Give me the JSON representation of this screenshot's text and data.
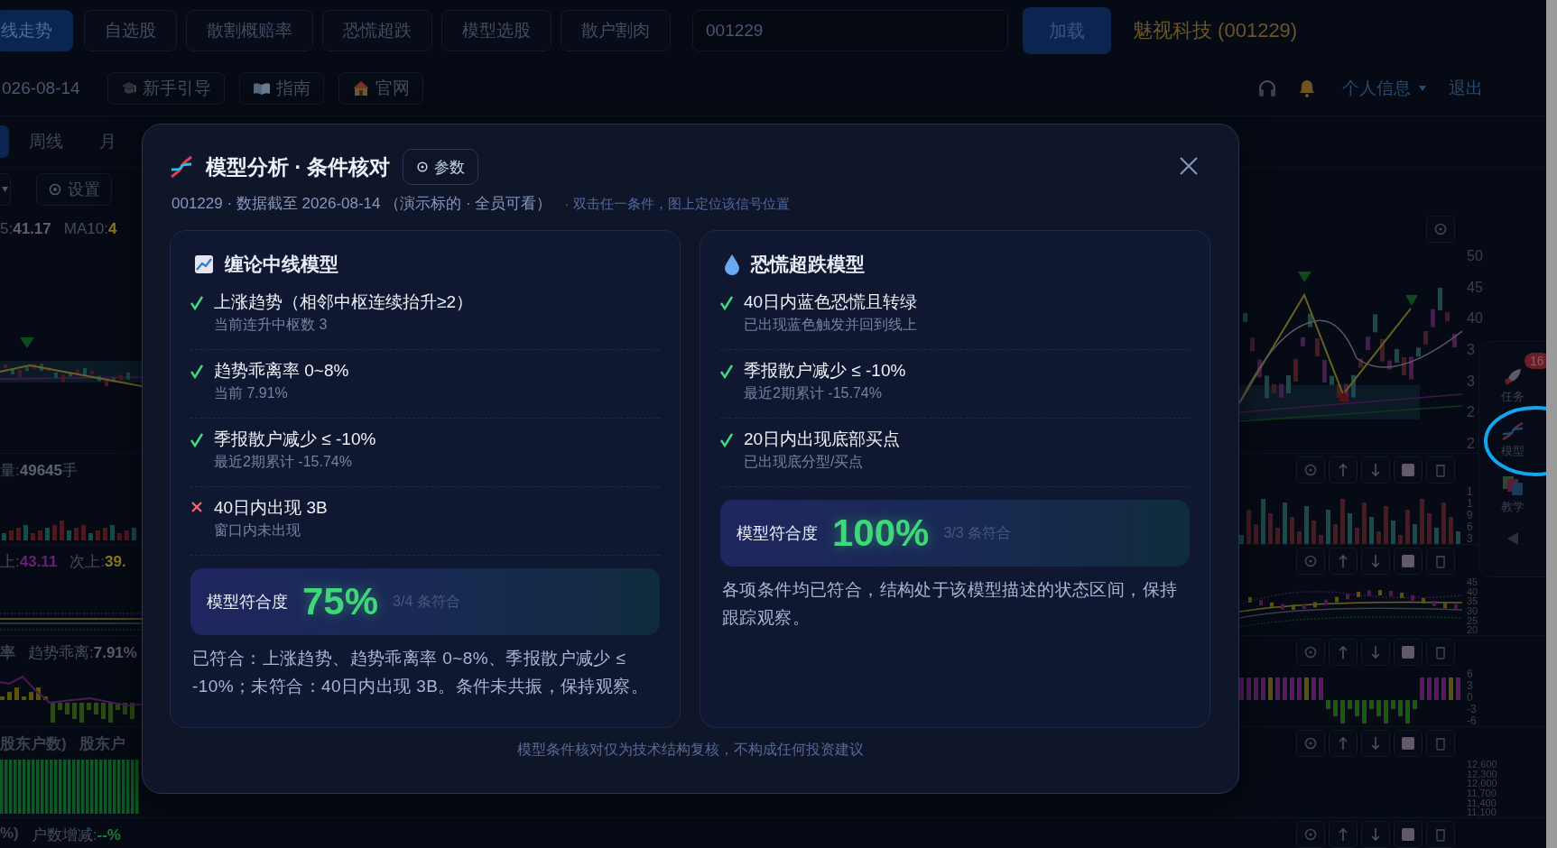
{
  "top_tabs": [
    {
      "label": "线走势",
      "selected": true
    },
    {
      "label": "自选股",
      "selected": false
    },
    {
      "label": "散割概赔率",
      "selected": false
    },
    {
      "label": "恐慌超跌",
      "selected": false
    },
    {
      "label": "模型选股",
      "selected": false
    },
    {
      "label": "散户割肉",
      "selected": false
    }
  ],
  "code_input": {
    "value": "001229"
  },
  "load_button": "加载",
  "stock_name": "魅视科技 (001229)",
  "date": "026-08-14",
  "link_buttons": [
    "新手引导",
    "指南",
    "官网"
  ],
  "user_menu": {
    "label": "个人信息",
    "logout": "退出"
  },
  "period_tabs": [
    {
      "selected": true
    },
    {
      "label": "周线",
      "selected": false
    },
    {
      "label": "月",
      "selected": false
    }
  ],
  "settings_button": "设置",
  "panes": [
    {
      "kind": "price",
      "labels": [
        {
          "label": "5:",
          "value": "41.17"
        },
        {
          "label": "MA10:",
          "value": "4",
          "color": "#8a7d1c"
        }
      ],
      "ticks": [
        "50",
        "45",
        "40",
        "3",
        "3",
        "2",
        "2"
      ]
    },
    {
      "kind": "volume",
      "labels": [
        {
          "label": "量:",
          "value": "49645",
          "suffix": "手"
        }
      ],
      "ticks": [
        "1",
        "1",
        "9",
        "6",
        "3"
      ]
    },
    {
      "kind": "lines",
      "labels": [
        {
          "label": "上:",
          "value": "43.11",
          "color": "#6a1f78"
        },
        {
          "label": "次上:",
          "value": "39.",
          "color": "#8a7d1c"
        }
      ],
      "ticks": [
        "45",
        "40",
        "35",
        "30",
        "25",
        "20"
      ]
    },
    {
      "kind": "macd",
      "labels": [
        {
          "label": "率"
        },
        {
          "label": "趋势乖离:",
          "value": "7.91%"
        }
      ],
      "ticks": [
        "6",
        "3",
        "0",
        "-3",
        "-6"
      ]
    },
    {
      "kind": "holders",
      "labels": [
        {
          "label": "股东户数)"
        },
        {
          "label": "股东户"
        }
      ],
      "ticks": [
        "12,600",
        "12,300",
        "12,000",
        "11,700",
        "11,400",
        "11,100"
      ]
    },
    {
      "kind": "change",
      "labels": [
        {
          "label": "%)"
        },
        {
          "label": "户数增减:",
          "value": "--%",
          "color": "#1f7a3a"
        }
      ]
    }
  ],
  "side_panel": [
    {
      "label": "任务",
      "badge": "16",
      "circled": false
    },
    {
      "label": "模型",
      "circled": true
    },
    {
      "label": "教学",
      "circled": false
    }
  ],
  "modal": {
    "title": "模型分析 · 条件核对",
    "params_button": "参数",
    "subtitle": "001229 · 数据截至 2026-08-14 （演示标的 · 全员可看）",
    "hint": "· 双击任一条件，图上定位该信号位置",
    "cards": [
      {
        "title": "缠论中线模型",
        "conditions": [
          {
            "text": "上涨趋势（相邻中枢连续抬升≥2）",
            "detail": "当前连升中枢数 3",
            "met": true
          },
          {
            "text": "趋势乖离率 0~8%",
            "detail": "当前 7.91%",
            "met": true
          },
          {
            "text": "季报散户减少 ≤ -10%",
            "detail": "最近2期累计 -15.74%",
            "met": true
          },
          {
            "text": "40日内出现 3B",
            "detail": "窗口内未出现",
            "met": false
          }
        ],
        "score_label": "模型符合度",
        "score": "75%",
        "score_count": "3/4 条符合",
        "summary": "已符合：上涨趋势、趋势乖离率 0~8%、季报散户减少 ≤ -10%；未符合：40日内出现 3B。条件未共振，保持观察。"
      },
      {
        "title": "恐慌超跌模型",
        "conditions": [
          {
            "text": "40日内蓝色恐慌且转绿",
            "detail": "已出现蓝色触发并回到线上",
            "met": true
          },
          {
            "text": "季报散户减少 ≤ -10%",
            "detail": "最近2期累计 -15.74%",
            "met": true
          },
          {
            "text": "20日内出现底部买点",
            "detail": "已出现底分型/买点",
            "met": true
          }
        ],
        "score_label": "模型符合度",
        "score": "100%",
        "score_count": "3/3 条符合",
        "summary": "各项条件均已符合，结构处于该模型描述的状态区间，保持跟踪观察。"
      }
    ],
    "disclaimer": "模型条件核对仅为技术结构复核，不构成任何投资建议"
  }
}
